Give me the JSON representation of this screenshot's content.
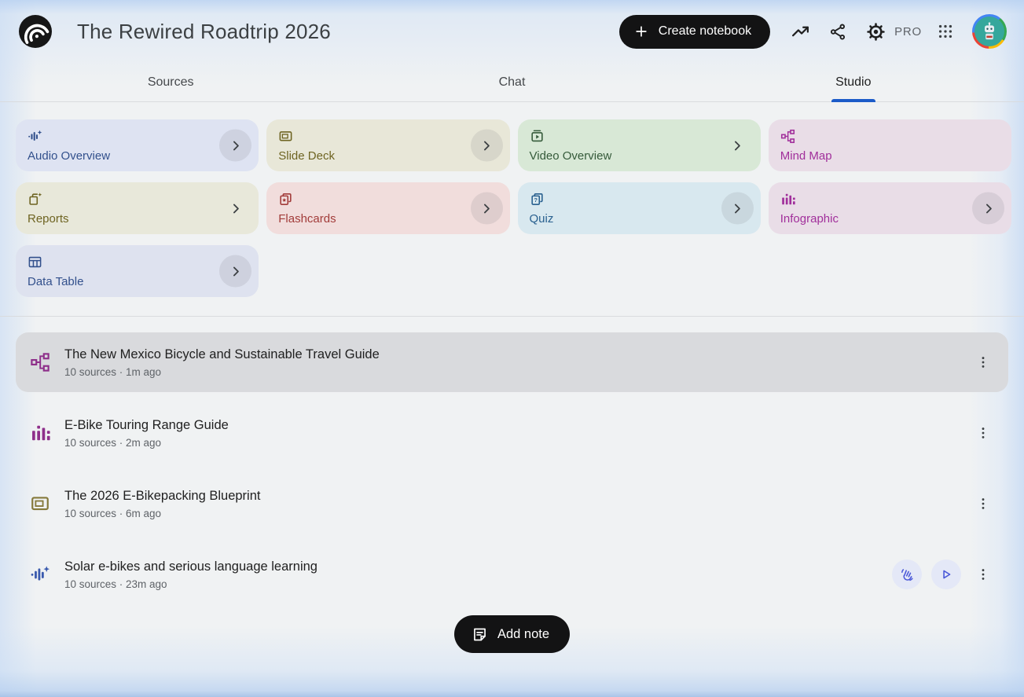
{
  "header": {
    "title": "The Rewired Roadtrip 2026",
    "create_button_label": "Create notebook",
    "pro_label": "PRO"
  },
  "tabs": [
    {
      "label": "Sources",
      "active": false
    },
    {
      "label": "Chat",
      "active": false
    },
    {
      "label": "Studio",
      "active": true
    }
  ],
  "accent": {
    "tab_underline": "#1b5bc8",
    "selected_row_bg": "#d9dadd"
  },
  "studio": {
    "cards": [
      {
        "label": "Audio Overview",
        "icon": "audio-waveform-icon",
        "bg": "#dee3f2",
        "fg": "#32508c",
        "chevron": "circle"
      },
      {
        "label": "Slide Deck",
        "icon": "slide-deck-icon",
        "bg": "#e8e7d8",
        "fg": "#6e6422",
        "chevron": "circle"
      },
      {
        "label": "Video Overview",
        "icon": "video-overview-icon",
        "bg": "#d8e8d6",
        "fg": "#355a3a",
        "chevron": "plain"
      },
      {
        "label": "Mind Map",
        "icon": "mind-map-icon",
        "bg": "#e9dde7",
        "fg": "#a12f9b",
        "chevron": "none"
      },
      {
        "label": "Reports",
        "icon": "reports-icon",
        "bg": "#e8e8da",
        "fg": "#6e6422",
        "chevron": "plain"
      },
      {
        "label": "Flashcards",
        "icon": "flashcards-icon",
        "bg": "#f1dddc",
        "fg": "#a23c3a",
        "chevron": "circle"
      },
      {
        "label": "Quiz",
        "icon": "quiz-icon",
        "bg": "#d8e8ef",
        "fg": "#29608f",
        "chevron": "circle"
      },
      {
        "label": "Infographic",
        "icon": "infographic-icon",
        "bg": "#e9dde7",
        "fg": "#a12f9b",
        "chevron": "circle"
      },
      {
        "label": "Data Table",
        "icon": "data-table-icon",
        "bg": "#dee2ef",
        "fg": "#32508c",
        "chevron": "circle"
      }
    ]
  },
  "artifacts": [
    {
      "title": "The New Mexico Bicycle and Sustainable Travel Guide",
      "meta": "10 sources · 1m ago",
      "icon": "mind-map-icon",
      "icon_color": "#8e2f8a",
      "selected": true,
      "audio_controls": false
    },
    {
      "title": "E-Bike Touring Range Guide",
      "meta": "10 sources · 2m ago",
      "icon": "infographic-icon",
      "icon_color": "#8e2f8a",
      "selected": false,
      "audio_controls": false
    },
    {
      "title": "The 2026 E-Bikepacking Blueprint",
      "meta": "10 sources · 6m ago",
      "icon": "slide-deck-icon",
      "icon_color": "#85793a",
      "selected": false,
      "audio_controls": false
    },
    {
      "title": "Solar e-bikes and serious language learning",
      "meta": "10 sources · 23m ago",
      "icon": "audio-waveform-icon",
      "icon_color": "#3a5aae",
      "selected": false,
      "audio_controls": true
    }
  ],
  "footer": {
    "add_note_label": "Add note"
  }
}
